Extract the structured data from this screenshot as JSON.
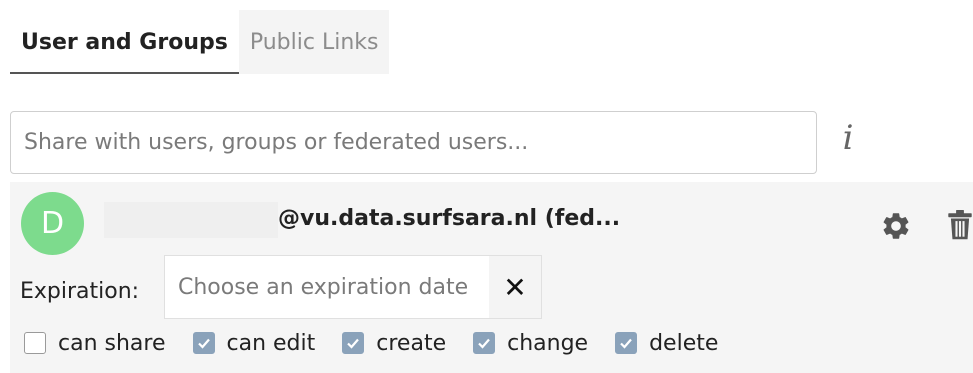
{
  "tabs": [
    {
      "label": "User and Groups",
      "active": true
    },
    {
      "label": "Public Links",
      "active": false
    }
  ],
  "search": {
    "placeholder": "Share with users, groups or federated users..."
  },
  "info_icon": "info-icon",
  "share": {
    "avatar_letter": "D",
    "avatar_color": "#7ddb8d",
    "username": "@vu.data.surfsara.nl (fed...",
    "expiration_label": "Expiration:",
    "expiration_placeholder": "Choose an expiration date",
    "clear_symbol": "✕",
    "permissions": [
      {
        "label": "can share",
        "checked": false
      },
      {
        "label": "can edit",
        "checked": true
      },
      {
        "label": "create",
        "checked": true
      },
      {
        "label": "change",
        "checked": true
      },
      {
        "label": "delete",
        "checked": true
      }
    ]
  },
  "colors": {
    "checkbox_checked": "#8aa2ba",
    "icon_gray": "#555555"
  }
}
